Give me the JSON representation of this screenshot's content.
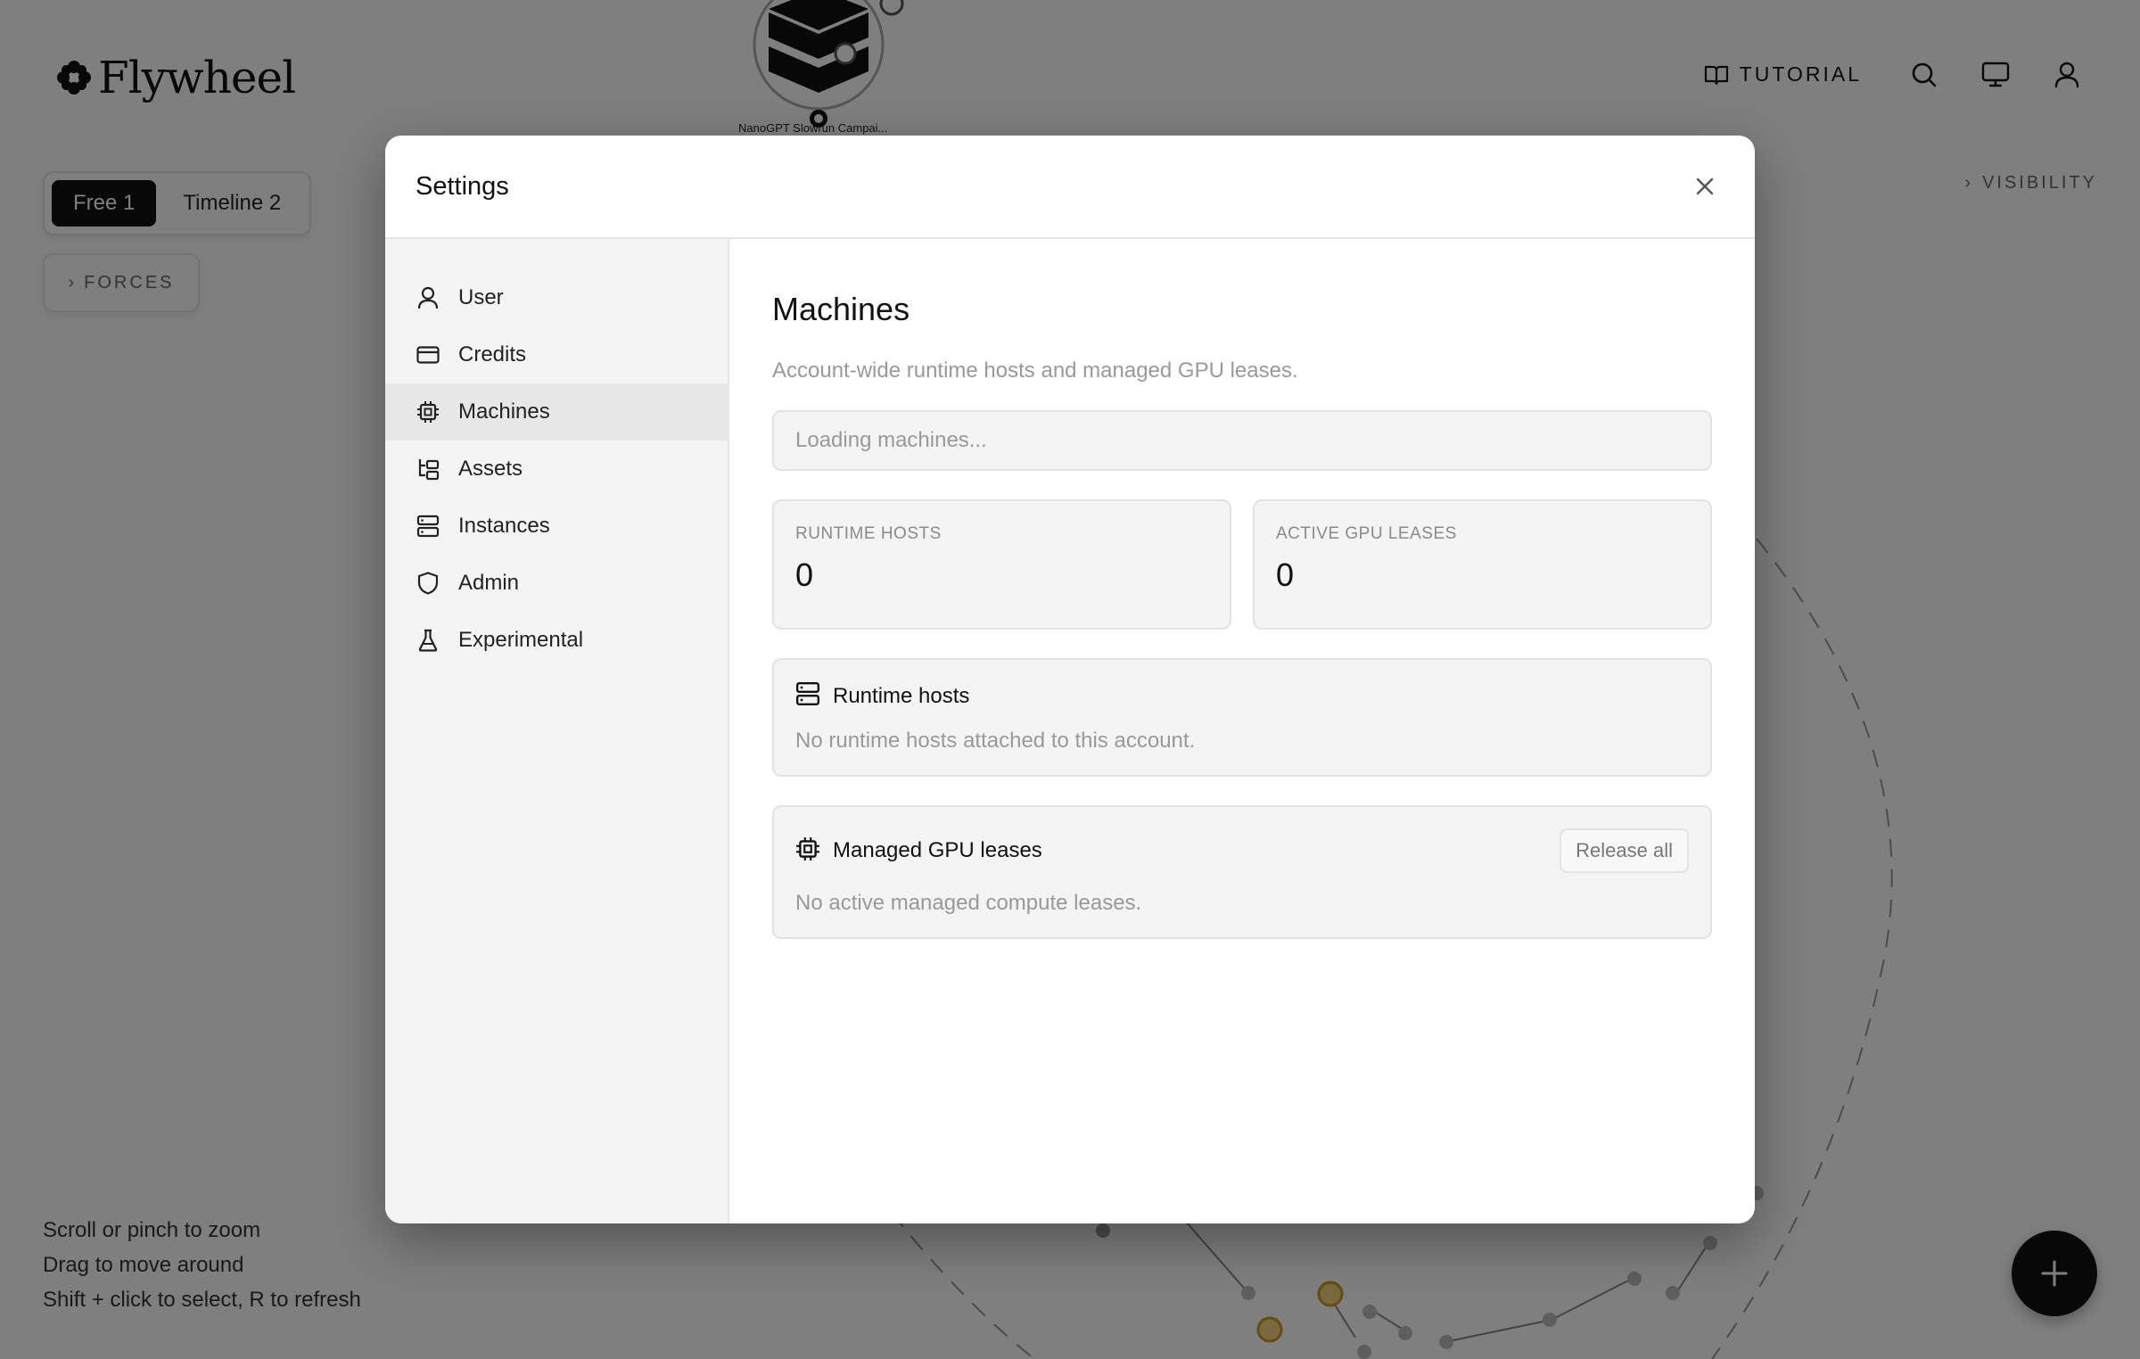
{
  "app": {
    "brand": "Flywheel",
    "nav": {
      "tutorial_label": "TUTORIAL",
      "search_icon": "search-icon",
      "monitor_icon": "monitor-icon",
      "user_icon": "user-icon"
    }
  },
  "canvas": {
    "timeline_tabs": [
      {
        "label": "Free 1",
        "active": true
      },
      {
        "label": "Timeline 2",
        "active": false
      }
    ],
    "forces_label": "FORCES",
    "visibility_label": "VISIBILITY",
    "node_label": "NanoGPT Slowrun Campai...",
    "help": [
      "Scroll or pinch to zoom",
      "Drag to move around",
      "Shift + click to select, R to refresh"
    ],
    "fab_label": "+"
  },
  "settings": {
    "title": "Settings",
    "close_label": "×",
    "sidebar": {
      "items": [
        {
          "label": "User",
          "icon": "user-icon",
          "active": false
        },
        {
          "label": "Credits",
          "icon": "credit-card-icon",
          "active": false
        },
        {
          "label": "Machines",
          "icon": "cpu-icon",
          "active": true
        },
        {
          "label": "Assets",
          "icon": "folder-tree-icon",
          "active": false
        },
        {
          "label": "Instances",
          "icon": "server-icon",
          "active": false
        },
        {
          "label": "Admin",
          "icon": "shield-icon",
          "active": false
        },
        {
          "label": "Experimental",
          "icon": "flask-icon",
          "active": false
        }
      ]
    },
    "machines": {
      "title": "Machines",
      "description": "Account-wide runtime hosts and managed GPU leases.",
      "loading_text": "Loading machines...",
      "stats": [
        {
          "label": "RUNTIME HOSTS",
          "value": "0"
        },
        {
          "label": "ACTIVE GPU LEASES",
          "value": "0"
        }
      ],
      "runtime_hosts": {
        "title": "Runtime hosts",
        "empty_text": "No runtime hosts attached to this account."
      },
      "gpu_leases": {
        "title": "Managed GPU leases",
        "release_all_label": "Release all",
        "empty_text": "No active managed compute leases."
      }
    }
  }
}
